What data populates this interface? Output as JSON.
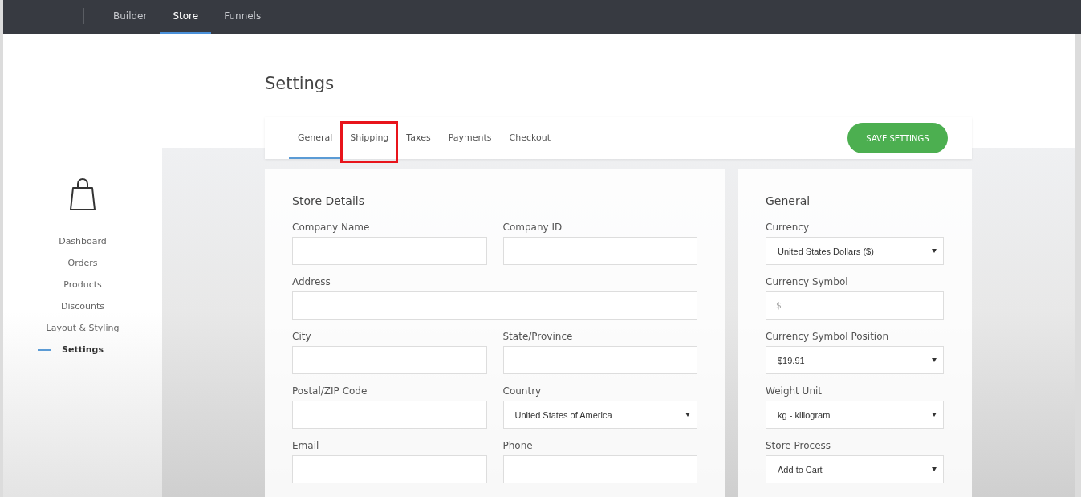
{
  "top_nav": [
    {
      "label": "Builder",
      "selected": false
    },
    {
      "label": "Store",
      "selected": true
    },
    {
      "label": "Funnels",
      "selected": false
    }
  ],
  "sidebar": {
    "items": [
      {
        "label": "Dashboard",
        "selected": false
      },
      {
        "label": "Orders",
        "selected": false
      },
      {
        "label": "Products",
        "selected": false
      },
      {
        "label": "Discounts",
        "selected": false
      },
      {
        "label": "Layout & Styling",
        "selected": false
      },
      {
        "label": "Settings",
        "selected": true
      }
    ]
  },
  "page_title": "Settings",
  "tabs": [
    {
      "label": "General",
      "selected": true,
      "highlighted": false
    },
    {
      "label": "Shipping",
      "selected": false,
      "highlighted": true
    },
    {
      "label": "Taxes",
      "selected": false,
      "highlighted": false
    },
    {
      "label": "Payments",
      "selected": false,
      "highlighted": false
    },
    {
      "label": "Checkout",
      "selected": false,
      "highlighted": false
    }
  ],
  "save_button": "SAVE SETTINGS",
  "store_details": {
    "title": "Store Details",
    "rows": [
      [
        {
          "label": "Company Name",
          "kind": "text"
        },
        {
          "label": "Company ID",
          "kind": "text"
        }
      ],
      [
        {
          "label": "Address",
          "kind": "text"
        }
      ],
      [
        {
          "label": "City",
          "kind": "text"
        },
        {
          "label": "State/Province",
          "kind": "text"
        }
      ],
      [
        {
          "label": "Postal/ZIP Code",
          "kind": "text"
        },
        {
          "label": "Country",
          "kind": "select",
          "value": "United States of America"
        }
      ],
      [
        {
          "label": "Email",
          "kind": "text"
        },
        {
          "label": "Phone",
          "kind": "text"
        }
      ]
    ]
  },
  "general": {
    "title": "General",
    "fields": [
      {
        "label": "Currency",
        "kind": "select",
        "value": "United States Dollars ($)"
      },
      {
        "label": "Currency Symbol",
        "kind": "text",
        "placeholder": "$"
      },
      {
        "label": "Currency Symbol Position",
        "kind": "select",
        "value": "$19.91"
      },
      {
        "label": "Weight Unit",
        "kind": "select",
        "value": "kg - killogram"
      },
      {
        "label": "Store Process",
        "kind": "select",
        "value": "Add to Cart"
      }
    ]
  }
}
